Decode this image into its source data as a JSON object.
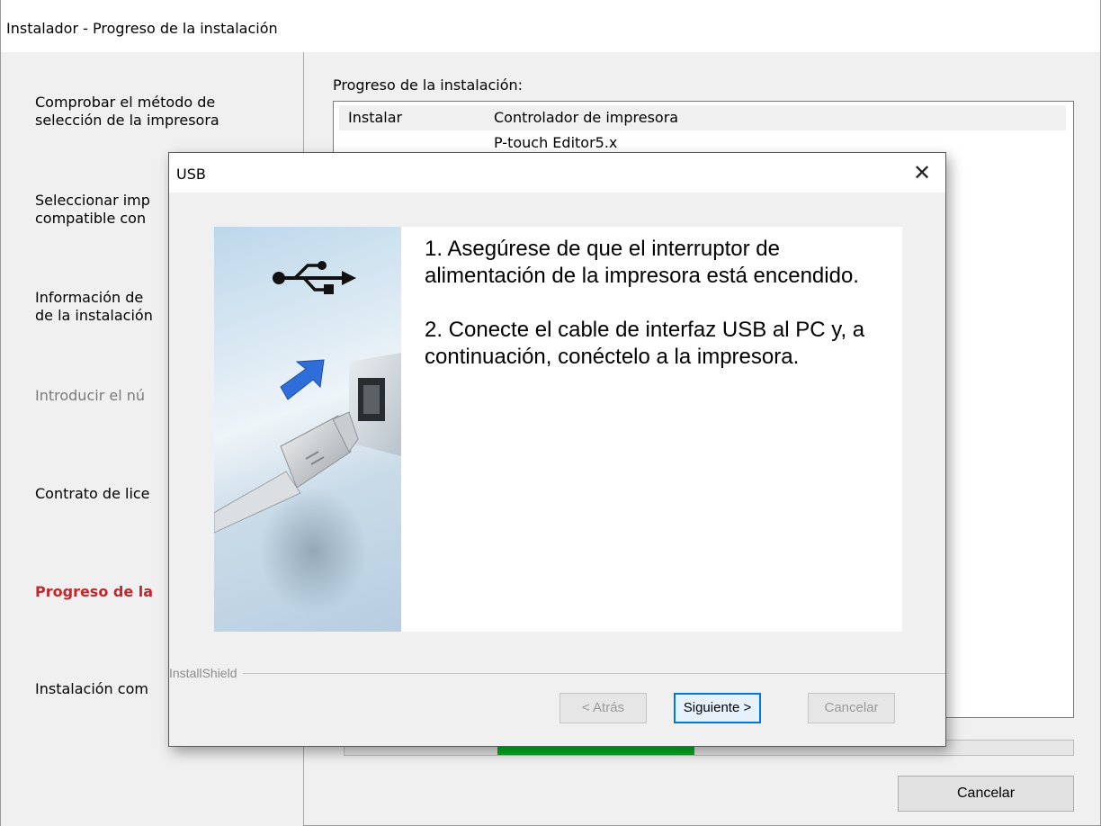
{
  "window": {
    "title": "Instalador - Progreso de la instalación"
  },
  "steps": [
    {
      "label": "Comprobar el método de\nselección de la impresora",
      "state": "normal"
    },
    {
      "label": "Seleccionar imp\ncompatible con",
      "state": "normal"
    },
    {
      "label": "Información de\nde la instalación",
      "state": "normal"
    },
    {
      "label": "Introducir el nú",
      "state": "disabled"
    },
    {
      "label": "Contrato de lice",
      "state": "normal"
    },
    {
      "label": "Progreso de la",
      "state": "active"
    },
    {
      "label": "Instalación com",
      "state": "normal"
    }
  ],
  "main": {
    "progress_label": "Progreso de la instalación:",
    "rows": [
      {
        "action": "Instalar",
        "item": "Controlador de impresora"
      },
      {
        "action": "",
        "item": "P-touch Editor5.x"
      }
    ],
    "progress": 0.27,
    "cancel_label": "Cancelar"
  },
  "dialog": {
    "title": "USB",
    "close_glyph": "✕",
    "instruction_1": "1. Asegúrese de que el interruptor de alimentación de la impresora está encendido.",
    "instruction_2": "2. Conecte el cable de interfaz USB al PC y, a continuación, conéctelo a la impresora.",
    "brand": "InstallShield",
    "back_label": "< Atrás",
    "next_label": "Siguiente >",
    "cancel_label": "Cancelar"
  },
  "colors": {
    "active_step": "#c0282d",
    "progress_fill": "#06b025",
    "usb_arrow": "#2f6ed8"
  },
  "icons": [
    "usb-symbol-icon",
    "insert-arrow-icon",
    "usb-cable-plug-icon",
    "usb-port-icon",
    "close-icon"
  ]
}
